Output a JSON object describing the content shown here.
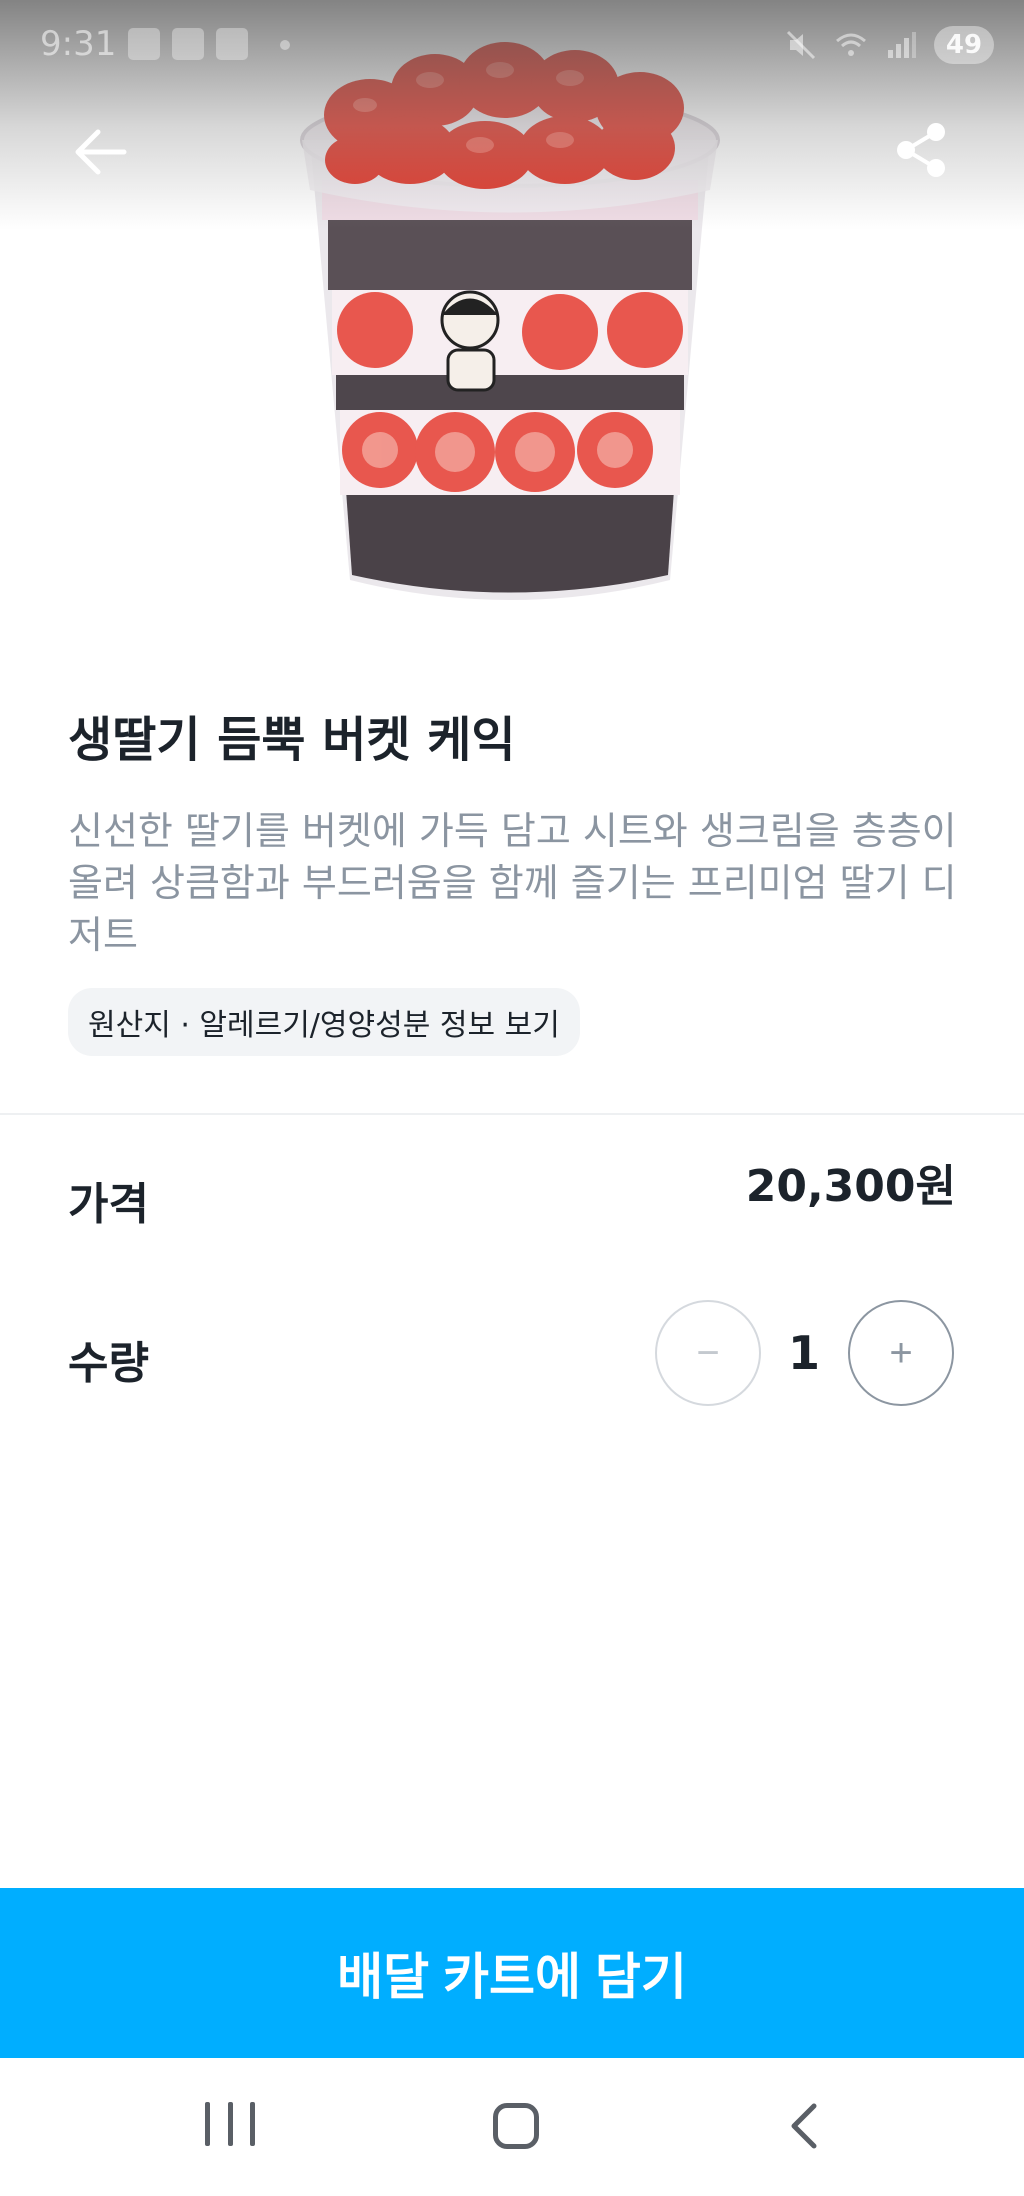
{
  "status_bar": {
    "time": "9:31",
    "battery": "49"
  },
  "product": {
    "name": "생딸기 듬뿍 버켓 케익",
    "description": "신선한 딸기를 버켓에 가득 담고 시트와 생크림을 층층이 올려 상큼함과 부드러움을 함께 즐기는 프리미엄 딸기 디저트",
    "info_link": "원산지 · 알레르기/영양성분 정보 보기"
  },
  "price": {
    "label": "가격",
    "value": "20,300원"
  },
  "quantity": {
    "label": "수량",
    "value": "1",
    "minus_symbol": "−",
    "plus_symbol": "+"
  },
  "cta": {
    "label": "배달 카트에 담기"
  },
  "icons": {
    "back": "arrow-left-icon",
    "share": "share-icon",
    "mute": "mute-icon",
    "wifi": "wifi-icon",
    "signal": "signal-icon"
  },
  "colors": {
    "accent": "#00aeff",
    "text_primary": "#1c232b",
    "text_secondary": "#8b95a1",
    "chip_background": "#f2f4f6"
  }
}
